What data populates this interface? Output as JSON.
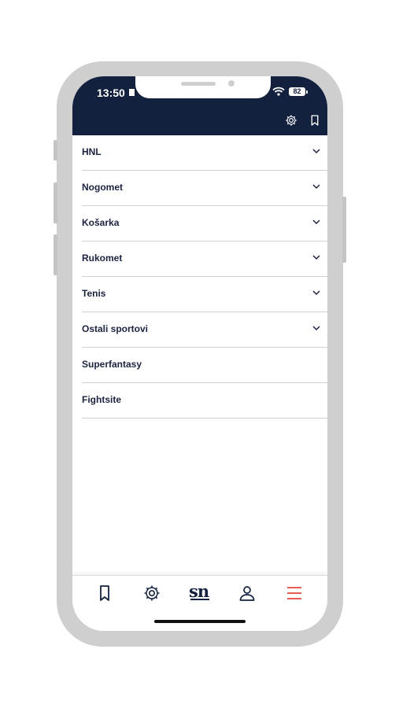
{
  "status_bar": {
    "time": "13:50",
    "battery": "82"
  },
  "header": {
    "icons": [
      "gear-icon",
      "bookmark-icon"
    ]
  },
  "menu": {
    "items": [
      {
        "label": "HNL",
        "expandable": true
      },
      {
        "label": "Nogomet",
        "expandable": true
      },
      {
        "label": "Košarka",
        "expandable": true
      },
      {
        "label": "Rukomet",
        "expandable": true
      },
      {
        "label": "Tenis",
        "expandable": true
      },
      {
        "label": "Ostali sportovi",
        "expandable": true
      },
      {
        "label": "Superfantasy",
        "expandable": false
      },
      {
        "label": "Fightsite",
        "expandable": false
      }
    ]
  },
  "tab_bar": {
    "logo_text": "sn",
    "items": [
      "bookmark-icon",
      "gear-icon",
      "sn-logo",
      "profile-icon",
      "hamburger-menu-icon"
    ],
    "active_color": "#e8453c"
  },
  "colors": {
    "header_bg": "#13213f",
    "text": "#1c2340"
  }
}
